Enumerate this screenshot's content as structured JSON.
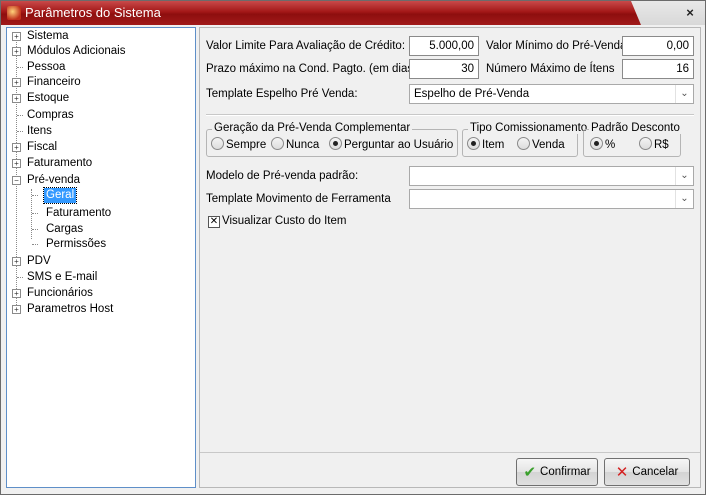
{
  "window": {
    "title": "Parâmetros do Sistema",
    "close_glyph": "×"
  },
  "tree": {
    "items": [
      {
        "label": "Sistema",
        "expander": "+"
      },
      {
        "label": "Módulos Adicionais",
        "expander": "+"
      },
      {
        "label": "Pessoa",
        "expander": ""
      },
      {
        "label": "Financeiro",
        "expander": "+"
      },
      {
        "label": "Estoque",
        "expander": "+"
      },
      {
        "label": "Compras",
        "expander": ""
      },
      {
        "label": "Itens",
        "expander": ""
      },
      {
        "label": "Fiscal",
        "expander": "+"
      },
      {
        "label": "Faturamento",
        "expander": "+"
      },
      {
        "label": "Pré-venda",
        "expander": "−"
      },
      {
        "label": "Geral",
        "expander": ""
      },
      {
        "label": "Faturamento",
        "expander": ""
      },
      {
        "label": "Cargas",
        "expander": ""
      },
      {
        "label": "Permissões",
        "expander": ""
      },
      {
        "label": "PDV",
        "expander": "+"
      },
      {
        "label": "SMS e E-mail",
        "expander": ""
      },
      {
        "label": "Funcionários",
        "expander": "+"
      },
      {
        "label": "Parametros Host",
        "expander": "+"
      }
    ]
  },
  "form": {
    "credit_limit_label": "Valor Limite Para Avaliação de Crédito:",
    "credit_limit_value": "5.000,00",
    "min_value_label": "Valor Mínimo do Pré-Venda:",
    "min_value_value": "0,00",
    "max_term_label": "Prazo máximo na Cond. Pagto. (em dias) :",
    "max_term_value": "30",
    "max_items_label": "Número Máximo de Ítens",
    "max_items_value": "16",
    "template_espelho_label": "Template Espelho Pré Venda:",
    "template_espelho_value": "Espelho de Pré-Venda",
    "geracao_group_title": "Geração da Pré-Venda Complementar",
    "geracao_options": [
      "Sempre",
      "Nunca",
      "Perguntar ao Usuário"
    ],
    "geracao_selected": "Perguntar ao Usuário",
    "comissao_group_title": "Tipo Comissionamento",
    "comissao_options": [
      "Item",
      "Venda"
    ],
    "comissao_selected": "Item",
    "desconto_group_title": "Padrão Desconto",
    "desconto_options": [
      "%",
      "R$"
    ],
    "desconto_selected": "%",
    "modelo_label": "Modelo de Pré-venda padrão:",
    "modelo_value": "",
    "template_movimento_label": "Template Movimento de Ferramenta",
    "template_movimento_value": "",
    "visualizar_custo_label": "Visualizar Custo do Item",
    "visualizar_custo_checked": true,
    "dropdown_glyph": "⌄",
    "check_glyph": "✕"
  },
  "buttons": {
    "confirm_label": "Confirmar",
    "confirm_icon": "check-icon",
    "confirm_glyph": "✔",
    "cancel_label": "Cancelar",
    "cancel_icon": "x-icon",
    "cancel_glyph": "✕",
    "confirm_color": "#3aa02c",
    "cancel_color": "#d42020"
  },
  "colors": {
    "title_bar": "#a31818",
    "tree_selection": "#3399ff"
  }
}
